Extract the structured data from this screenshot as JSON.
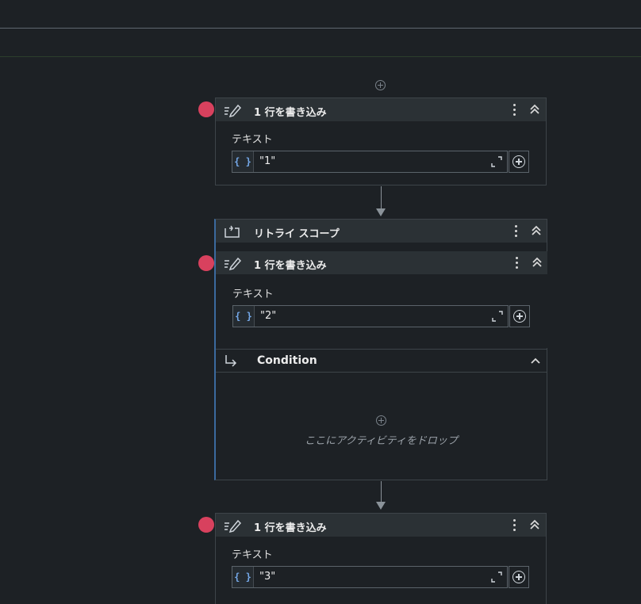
{
  "activities": [
    {
      "title": "1 行を書き込み",
      "field_label": "テキスト",
      "field_value": "\"1\""
    },
    {
      "title": "1 行を書き込み",
      "field_label": "テキスト",
      "field_value": "\"2\""
    },
    {
      "title": "1 行を書き込み",
      "field_label": "テキスト",
      "field_value": "\"3\""
    }
  ],
  "retry_scope": {
    "title": "リトライ スコープ",
    "condition_label": "Condition",
    "drop_placeholder": "ここにアクティビティをドロップ"
  },
  "icons": {
    "brace": "{ }",
    "write_line": "write-line-icon",
    "retry": "retry-scope-icon",
    "condition": "condition-arrow-icon"
  },
  "colors": {
    "background": "#1d2125",
    "header": "#2b3135",
    "breakpoint": "#d8415e",
    "accent": "#74a8e8"
  }
}
